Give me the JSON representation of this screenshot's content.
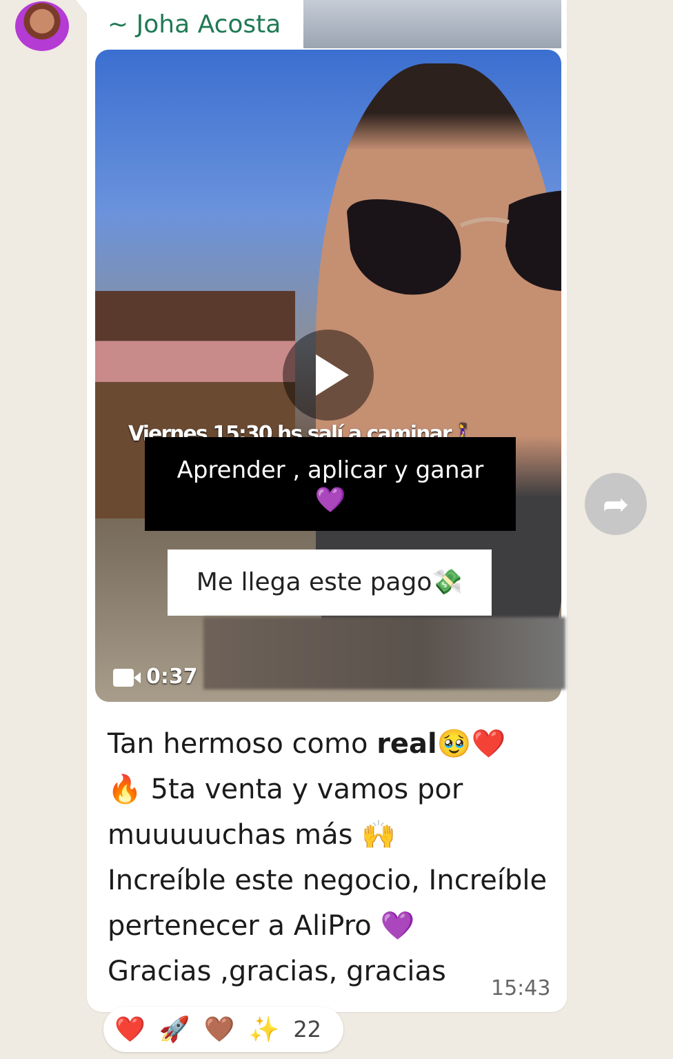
{
  "sender": {
    "name": "~ Joha Acosta"
  },
  "video": {
    "caption_top": "Viernes 15:30 hs salí a caminar🚶‍♀️",
    "caption_black": "Aprender , aplicar y ganar",
    "caption_black_emoji": "💜",
    "caption_white": "Me llega este pago💸",
    "duration": "0:37",
    "play_icon": "play-icon",
    "camera_icon": "video-camera-icon"
  },
  "message": {
    "line1_prefix": "Tan hermoso como ",
    "line1_bold": "real",
    "line1_suffix": "🥹❤️",
    "line2": "🔥 5ta venta y vamos por",
    "line3": "muuuuuchas más 🙌",
    "line4": "Increíble este negocio,  Increíble",
    "line5": "pertenecer a AliPro 💜",
    "line6": "Gracias ,gracias, gracias",
    "time": "15:43"
  },
  "forward": {
    "icon": "forward-icon"
  },
  "reactions": {
    "emojis": [
      "❤️",
      "🚀",
      "🤎",
      "✨"
    ],
    "count": "22"
  },
  "colors": {
    "sender_name": "#1f7a55",
    "background": "#efeae2",
    "bubble": "#ffffff"
  }
}
